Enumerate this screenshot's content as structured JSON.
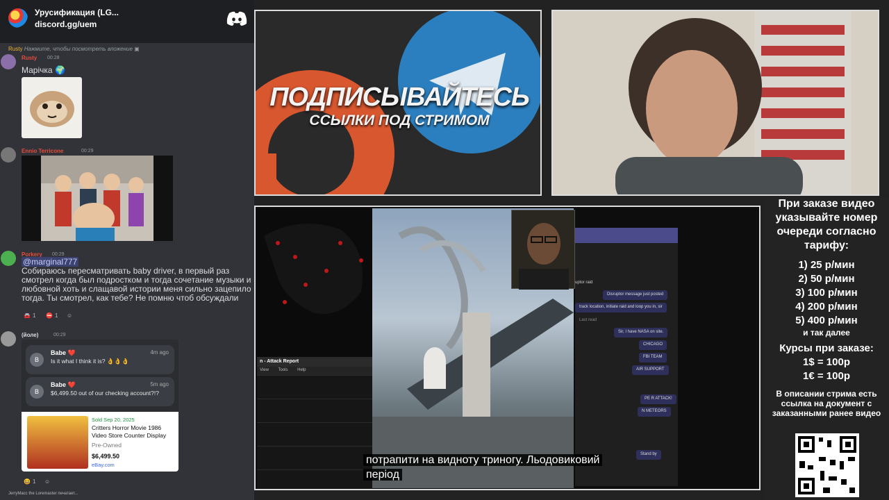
{
  "discord": {
    "server_name": "Урусификация (LG...",
    "server_invite": "discord.gg/uem",
    "messages": [
      {
        "reply_user": "Rusty",
        "reply_text": "Нажмите, чтобы посмотреть вложение",
        "author": "Rusty",
        "time": "00:28",
        "text": "Марічка"
      },
      {
        "author": "Ennio Terricone",
        "time": "00:29"
      },
      {
        "author": "Porkery",
        "time": "00:29",
        "mention": "@marginal777",
        "text": "Собираюсь пересматривать baby driver, в первый раз смотрел когда был подростком и тогда сочетание музыки и любовной хоть и слащавой истории меня сильно зацепило тогда. Ты смотрел, как тебе? Не помню чтоб обсуждали",
        "reactions": [
          "1",
          "1"
        ]
      },
      {
        "author": "(йоле)",
        "time": "00:29",
        "reactions": [
          "1"
        ]
      }
    ],
    "ebay_card": {
      "notif1": {
        "who": "Babe ❤️",
        "ago": "4m ago",
        "text": "Is it what I think it is? 👌👌👌"
      },
      "notif2": {
        "who": "Babe ❤️",
        "ago": "5m ago",
        "text": "$6,499.50 out of our checking account?!?"
      },
      "sold": "Sold  Sep 20, 2025",
      "title": "Critters Horror Movie 1986 Video Store Counter Display",
      "condition": "Pre-Owned",
      "price": "$6,499.50",
      "site": "eBay.com"
    },
    "typing": "JerryMacc the Loremaster печатает..."
  },
  "banner": {
    "title": "ПОДПИСЫВАЙТЕСЬ",
    "subtitle": "ССЫЛКИ ПОД СТРИМОМ"
  },
  "video": {
    "attack_report_title": "n - Attack Report",
    "attack_menu": [
      "View",
      "Tools",
      "Help"
    ],
    "teams_lines": [
      "uptor raid",
      "Disruptor message just posted",
      "track location, initiate raid and loop you in, sir",
      "Last read",
      "Sir, I have NASA on site.",
      "CHICAGO",
      "FBI TEAM",
      "AIR SUPPORT",
      "PE R ATTACK!",
      "N METEORS",
      "Stand by"
    ],
    "subtitle_line1": "потрапити на видноту триногу.  Льодовиковий",
    "subtitle_line2": "період"
  },
  "info": {
    "heading": "При заказе видео указывайте номер очереди согласно тарифу:",
    "tariffs": [
      "1) 25 р/мин",
      "2) 50 р/мин",
      "3) 100 р/мин",
      "4) 200 р/мин",
      "5) 400 р/мин"
    ],
    "etc": "и так далее",
    "courses_heading": "Курсы при заказе:",
    "courses": [
      "1$ = 100р",
      "1€ = 100р"
    ],
    "description": "В описании стрима есть ссылка на документ с заказанными ранее видео"
  }
}
